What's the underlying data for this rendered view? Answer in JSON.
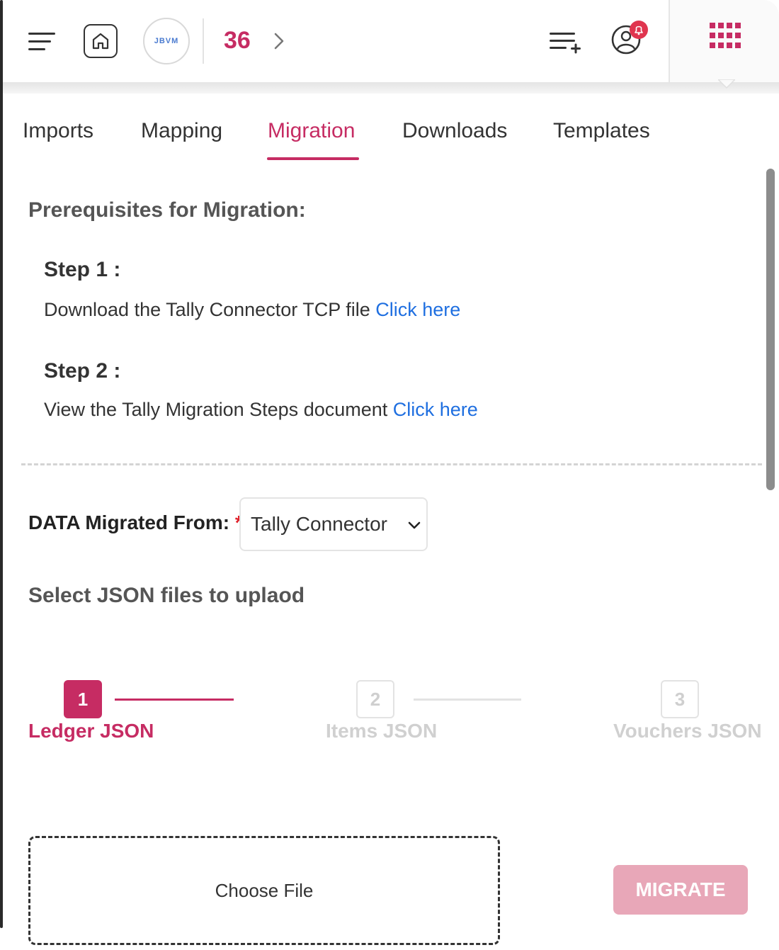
{
  "header": {
    "logo_text": "JBVM",
    "count": "36",
    "notification_badge_icon": "bell-icon",
    "colors": {
      "accent": "#c62c63",
      "link": "#1f6fe0"
    }
  },
  "tabs": [
    {
      "label": "Imports",
      "active": false
    },
    {
      "label": "Mapping",
      "active": false
    },
    {
      "label": "Migration",
      "active": true
    },
    {
      "label": "Downloads",
      "active": false
    },
    {
      "label": "Templates",
      "active": false
    }
  ],
  "prereq": {
    "title": "Prerequisites for Migration:",
    "steps": [
      {
        "title": "Step 1 :",
        "text": "Download the Tally Connector TCP file",
        "link": "Click here"
      },
      {
        "title": "Step 2 :",
        "text": "View the Tally Migration Steps document",
        "link": "Click here"
      }
    ]
  },
  "form": {
    "migrated_label": "DATA Migrated From:",
    "required_mark": "*",
    "selected": "Tally Connector",
    "json_title": "Select JSON files to uplaod"
  },
  "stepper": [
    {
      "number": "1",
      "label": "Ledger JSON",
      "state": "active"
    },
    {
      "number": "2",
      "label": "Items JSON",
      "state": "inactive"
    },
    {
      "number": "3",
      "label": "Vouchers JSON",
      "state": "inactive"
    }
  ],
  "upload": {
    "choose_file": "Choose File",
    "migrate_label": "MIGRATE"
  }
}
